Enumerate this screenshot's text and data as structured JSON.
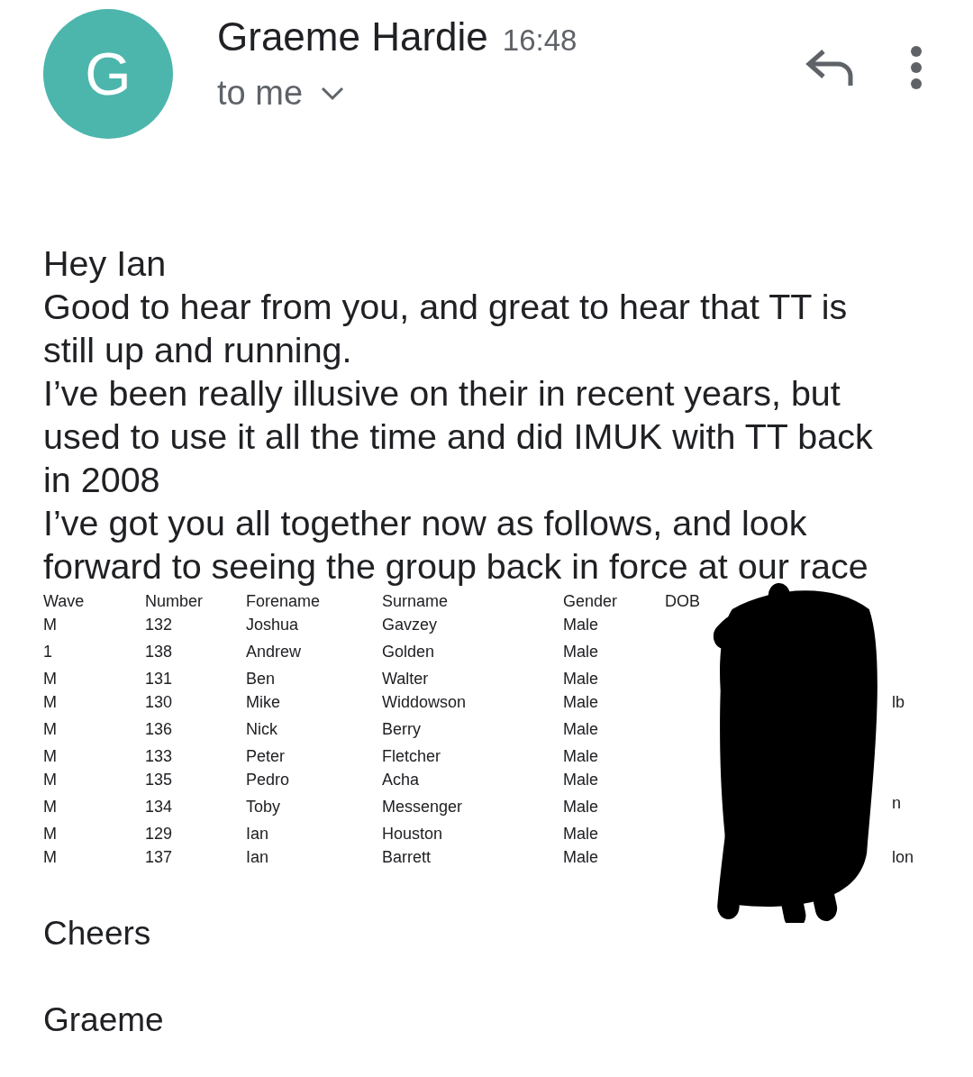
{
  "header": {
    "avatar_letter": "G",
    "sender": "Graeme Hardie",
    "time": "16:48",
    "recipient": "to me"
  },
  "body": {
    "paragraphs": [
      "Hey Ian",
      "Good to hear from you, and great to hear that TT is still up and running.",
      "I’ve been really illusive on their in recent years, but used to use it all the time and did IMUK with TT back in 2008",
      "I’ve got you all together now as follows, and look forward to seeing the group back in force at our race"
    ]
  },
  "table": {
    "columns": [
      "Wave",
      "Number",
      "Forename",
      "Surname",
      "Gender",
      "DOB"
    ],
    "rows": [
      {
        "cells": [
          "M",
          "132",
          "Joshua",
          "Gavzey",
          "Male"
        ]
      },
      {
        "cells": [
          "1",
          "138",
          "Andrew",
          "Golden",
          "Male"
        ]
      },
      {
        "cells": [
          "M",
          "131",
          "Ben",
          "Walter",
          "Male"
        ]
      },
      {
        "cells": [
          "M",
          "130",
          "Mike",
          "Widdowson",
          "Male"
        ],
        "column_7": "lb"
      },
      {
        "cells": [
          "M",
          "136",
          "Nick",
          "Berry",
          "Male"
        ]
      },
      {
        "cells": [
          "M",
          "133",
          "Peter",
          "Fletcher",
          "Male"
        ]
      },
      {
        "cells": [
          "M",
          "135",
          "Pedro",
          "Acha",
          "Male"
        ]
      },
      {
        "cells": [
          "M",
          "134",
          "Toby",
          "Messenger",
          "Male"
        ],
        "column_7": "n"
      },
      {
        "cells": [
          "M",
          "129",
          "Ian",
          "Houston",
          "Male"
        ]
      },
      {
        "cells": [
          "M",
          "137",
          "Ian",
          "Barrett",
          "Male"
        ],
        "column_7": "lon"
      }
    ]
  },
  "closing": [
    "Cheers",
    "Graeme"
  ]
}
